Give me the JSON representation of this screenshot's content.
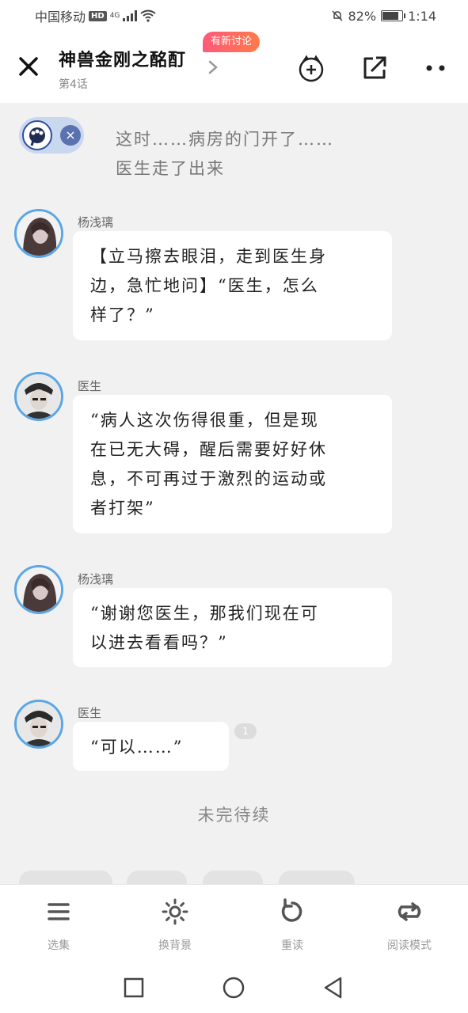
{
  "status_bar": {
    "carrier": "中国移动",
    "hd": "HD",
    "network": "4G",
    "battery": "82%",
    "battery_level": 0.82,
    "time": "1:14"
  },
  "header": {
    "title": "神兽金刚之酩酊",
    "chapter": "第4话",
    "new_badge": "有新讨论",
    "icons": [
      "close-icon",
      "chevron-right-icon",
      "add-favorite-icon",
      "share-icon",
      "more-icon"
    ]
  },
  "narration": {
    "text_line1": "这时……病房的门开了……",
    "text_line2": "医生走了出来"
  },
  "messages": [
    {
      "speaker": "杨浅璃",
      "lines": [
        "【立马擦去眼泪，走到医生身",
        "边，急忙地问】“医生，怎么",
        "样了？”"
      ]
    },
    {
      "speaker": "医生",
      "lines": [
        "“病人这次伤得很重，但是现",
        "在已无大碍，醒后需要好好休",
        "息，不可再过于激烈的运动或",
        "者打架”"
      ]
    },
    {
      "speaker": "杨浅璃",
      "lines": [
        "“谢谢您医生，那我们现在可",
        "以进去看看吗？”"
      ]
    },
    {
      "speaker": "医生",
      "lines": [
        "“可以……”"
      ],
      "read_count": "1"
    }
  ],
  "to_be_continued": "未完待续",
  "toolbar": {
    "items": [
      {
        "label": "选集",
        "icon": "menu-icon"
      },
      {
        "label": "换背景",
        "icon": "sun-icon"
      },
      {
        "label": "重读",
        "icon": "reload-icon"
      },
      {
        "label": "阅读模式",
        "icon": "loop-icon"
      }
    ]
  },
  "colors": {
    "accent_blue": "#5aa6e6",
    "badge_gradient_start": "#ff5a7a",
    "badge_gradient_end": "#ff7a4a",
    "background": "#f1f1f1"
  }
}
